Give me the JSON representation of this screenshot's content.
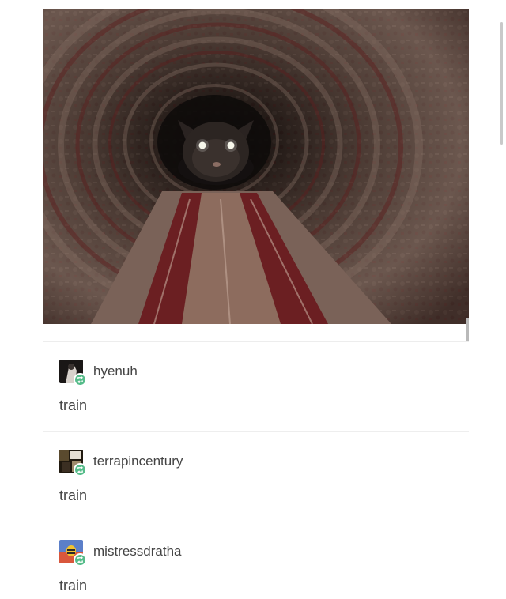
{
  "post": {
    "image_alt": "cat at the end of a rolled carpet tunnel"
  },
  "reblogs": [
    {
      "username": "hyenuh",
      "comment": "train",
      "avatar_icon": "user-avatar-dark"
    },
    {
      "username": "terrapincentury",
      "comment": "train",
      "avatar_icon": "user-avatar-collage"
    },
    {
      "username": "mistressdratha",
      "comment": "train",
      "avatar_icon": "user-avatar-bee"
    }
  ],
  "icons": {
    "reblog_badge": "reblog-icon"
  },
  "colors": {
    "reblog_badge": "#56bc8a",
    "text": "#444444",
    "divider": "#eeeeee"
  }
}
